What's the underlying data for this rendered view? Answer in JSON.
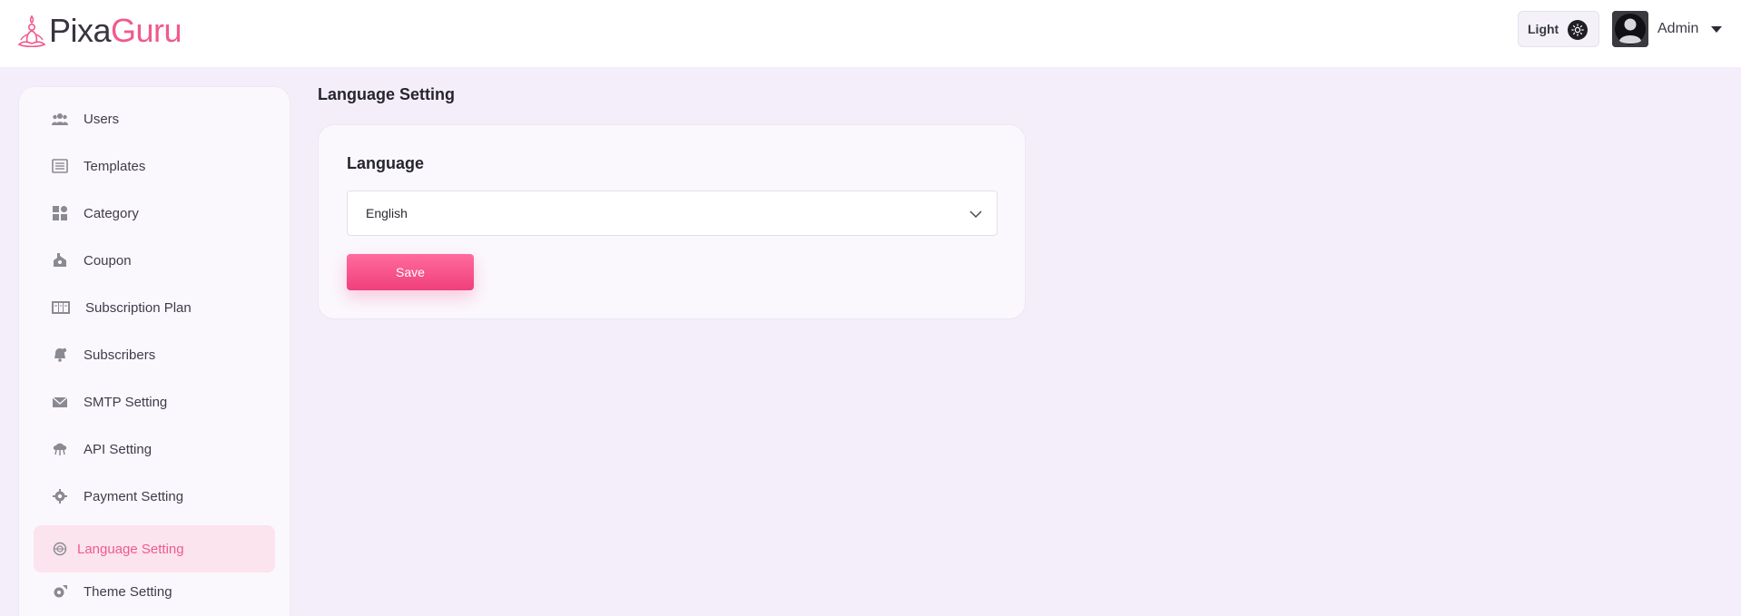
{
  "brand": {
    "name_part1": "Pixa",
    "name_part2": "Guru",
    "color_accent": "#f05a8c"
  },
  "header": {
    "theme_label": "Light",
    "theme_icon": "sun-icon",
    "user_name": "Admin"
  },
  "sidebar": {
    "items": [
      {
        "label": "Users",
        "icon": "users-icon"
      },
      {
        "label": "Templates",
        "icon": "templates-icon"
      },
      {
        "label": "Category",
        "icon": "category-icon"
      },
      {
        "label": "Coupon",
        "icon": "coupon-icon"
      },
      {
        "label": "Subscription Plan",
        "icon": "subscription-icon"
      },
      {
        "label": "Subscribers",
        "icon": "subscribers-icon"
      },
      {
        "label": "SMTP Setting",
        "icon": "mail-icon"
      },
      {
        "label": "API Setting",
        "icon": "api-icon"
      },
      {
        "label": "Payment Setting",
        "icon": "gear-icon"
      },
      {
        "label": "Language Setting",
        "icon": "globe-icon",
        "active": true
      },
      {
        "label": "Theme Setting",
        "icon": "theme-icon"
      }
    ]
  },
  "main": {
    "page_title": "Language Setting",
    "card_title": "Language",
    "language_value": "English",
    "save_label": "Save"
  }
}
